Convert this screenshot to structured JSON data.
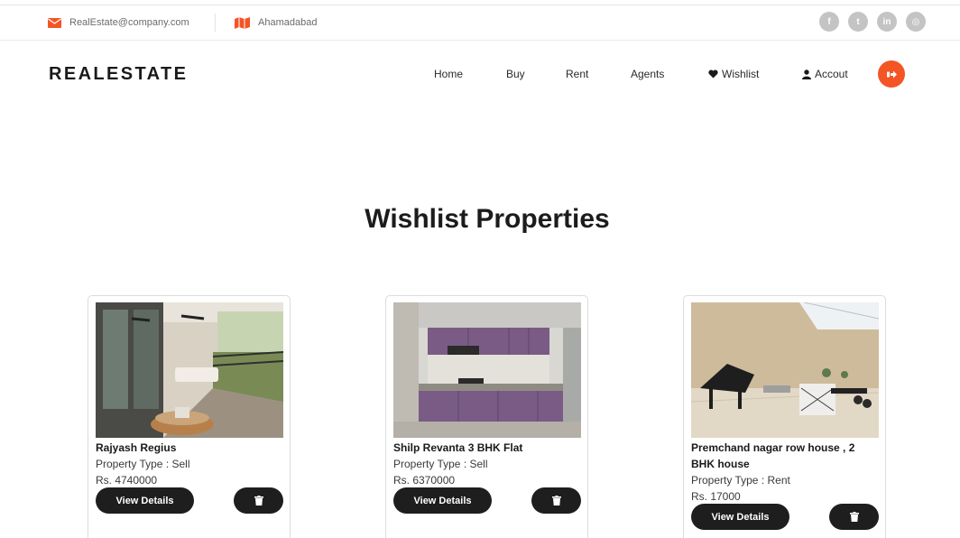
{
  "topbar": {
    "email": "RealEstate@company.com",
    "location": "Ahamadabad",
    "social": [
      {
        "icon": "facebook-icon",
        "glyph": "f"
      },
      {
        "icon": "twitter-icon",
        "glyph": "t"
      },
      {
        "icon": "linkedin-icon",
        "glyph": "in"
      },
      {
        "icon": "instagram-icon",
        "glyph": "◎"
      }
    ]
  },
  "nav": {
    "logo": "REALESTATE",
    "home": "Home",
    "buy": "Buy",
    "rent": "Rent",
    "agents": "Agents",
    "wishlist": "Wishlist",
    "account": "Accout"
  },
  "page": {
    "title": "Wishlist Properties"
  },
  "properties": [
    {
      "name": "Rajyash Regius",
      "type": "Property Type : Sell",
      "price": "Rs. 4740000",
      "view_label": "View Details"
    },
    {
      "name": "Shilp Revanta 3 BHK Flat",
      "type": "Property Type : Sell",
      "price": "Rs. 6370000",
      "view_label": "View Details"
    },
    {
      "name": "Premchand nagar row house , 2 BHK house",
      "type": "Property Type : Rent",
      "price": "Rs. 17000",
      "view_label": "View Details"
    }
  ],
  "colors": {
    "accent": "#f35525",
    "dark": "#1e1e1e",
    "muted": "#c4c4c4"
  }
}
